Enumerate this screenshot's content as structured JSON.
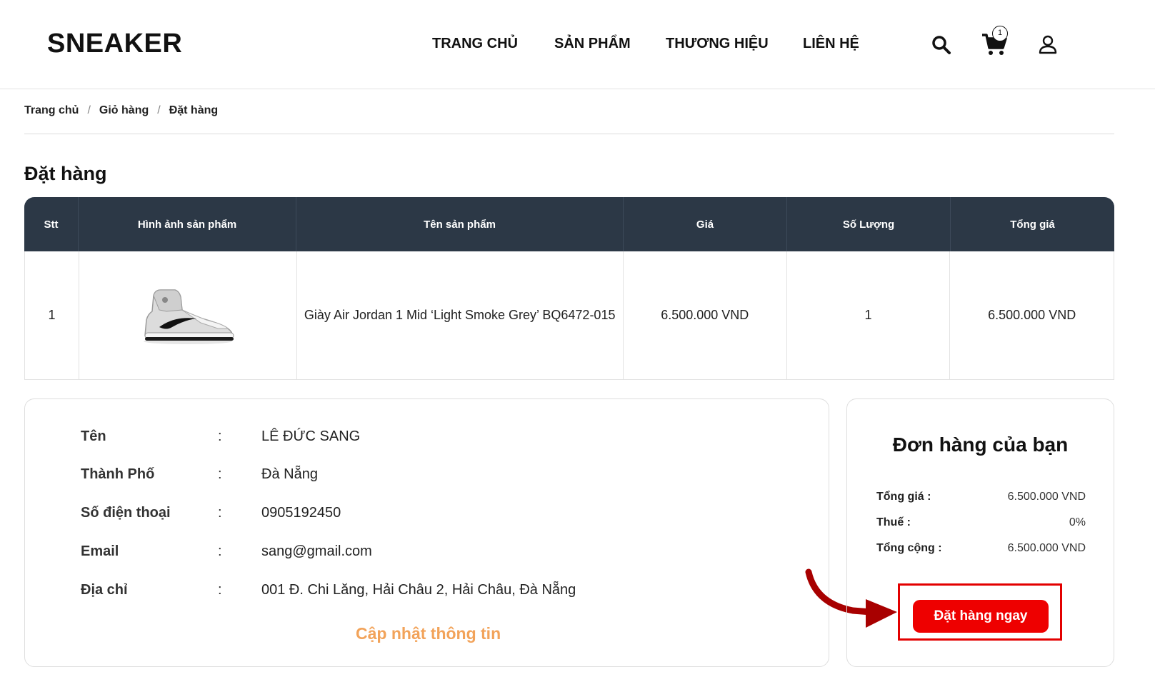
{
  "header": {
    "logo": "SNEAKER",
    "nav": [
      "TRANG CHỦ",
      "SẢN PHẨM",
      "THƯƠNG HIỆU",
      "LIÊN HỆ"
    ],
    "icons": [
      "search-icon",
      "cart-icon",
      "user-icon"
    ],
    "cart_count": "1"
  },
  "breadcrumb": [
    "Trang chủ",
    "Giỏ hàng",
    "Đặt hàng"
  ],
  "page_title": "Đặt hàng",
  "table": {
    "headers": [
      "Stt",
      "Hình ảnh sản phẩm",
      "Tên sản phẩm",
      "Giá",
      "Số Lượng",
      "Tổng giá"
    ],
    "rows": [
      {
        "stt": "1",
        "image": "sneaker-image",
        "name": "Giày Air Jordan 1 Mid ‘Light Smoke Grey’ BQ6472-015",
        "price": "6.500.000 VND",
        "qty": "1",
        "total": "6.500.000 VND"
      }
    ]
  },
  "customer": {
    "colon": ":",
    "fields": [
      {
        "label": "Tên",
        "value": "LÊ ĐỨC SANG"
      },
      {
        "label": "Thành Phố",
        "value": "Đà Nẵng"
      },
      {
        "label": "Số điện thoại",
        "value": "0905192450"
      },
      {
        "label": "Email",
        "value": "sang@gmail.com"
      },
      {
        "label": "Địa chỉ",
        "value": "001 Đ. Chi Lăng, Hải Châu 2, Hải Châu, Đà Nẵng"
      }
    ],
    "update_link": "Cập nhật thông tin"
  },
  "summary": {
    "title": "Đơn hàng của bạn",
    "rows": [
      {
        "label": "Tổng giá :",
        "value": "6.500.000 VND"
      },
      {
        "label": "Thuế :",
        "value": "0%"
      },
      {
        "label": "Tổng cộng :",
        "value": "6.500.000 VND"
      }
    ],
    "order_button": "Đặt hàng ngay"
  },
  "colors": {
    "table_header": "#2c3846",
    "accent_orange": "#f2a35a",
    "button_red": "#ee0000",
    "highlight_red": "#e30000",
    "arrow_red": "#a80000"
  }
}
